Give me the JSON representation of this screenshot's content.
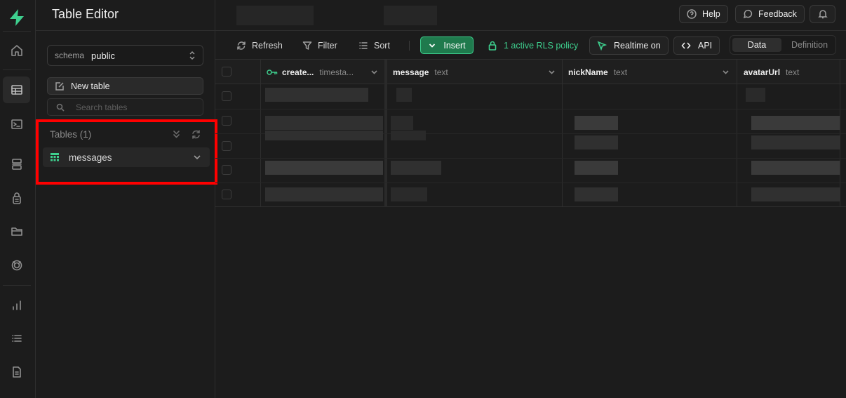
{
  "app": {
    "title": "Table Editor",
    "accent_color": "#3ecf8e",
    "highlight_color": "#ff0000"
  },
  "rail": {
    "logo": "supabase-logo",
    "items": [
      {
        "icon": "home-icon"
      },
      {
        "icon": "table-editor-icon",
        "active": true
      },
      {
        "icon": "sql-editor-icon"
      },
      {
        "icon": "database-icon"
      },
      {
        "icon": "auth-icon"
      },
      {
        "icon": "storage-icon"
      },
      {
        "icon": "realtime-icon"
      },
      {
        "icon": "reports-icon"
      },
      {
        "icon": "logs-icon"
      },
      {
        "icon": "docs-icon"
      }
    ]
  },
  "sidebar": {
    "schema_label": "schema",
    "schema_value": "public",
    "new_table_label": "New table",
    "search_placeholder": "Search tables",
    "tables_heading": "Tables (1)",
    "tables": [
      {
        "name": "messages"
      }
    ]
  },
  "topbar": {
    "help_label": "Help",
    "feedback_label": "Feedback"
  },
  "toolbar": {
    "refresh_label": "Refresh",
    "filter_label": "Filter",
    "sort_label": "Sort",
    "insert_label": "Insert",
    "rls_label": "1 active RLS policy",
    "realtime_label": "Realtime on",
    "api_label": "API",
    "tabs": [
      "Data",
      "Definition"
    ],
    "active_tab": "Data"
  },
  "grid": {
    "columns": [
      {
        "name": "create...",
        "type": "timesta...",
        "primary_key": true
      },
      {
        "name": "message",
        "type": "text"
      },
      {
        "name": "nickName",
        "type": "text"
      },
      {
        "name": "avatarUrl",
        "type": "text"
      }
    ],
    "row_count": 5
  }
}
